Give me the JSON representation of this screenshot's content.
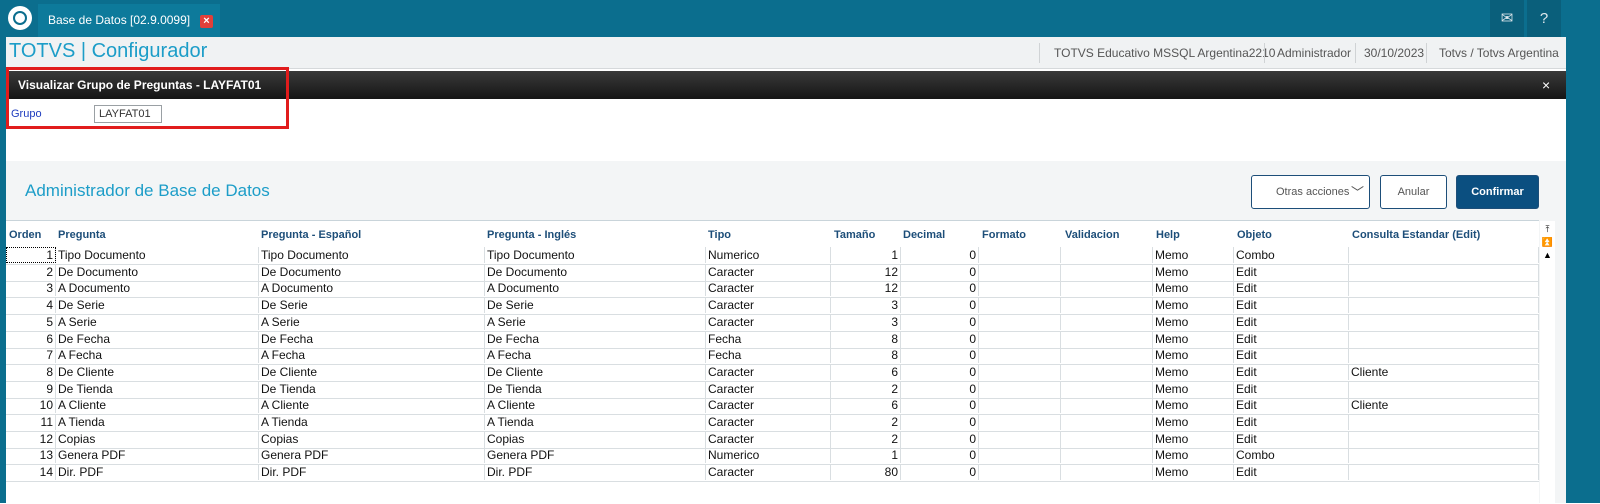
{
  "tab": {
    "title": "Base de Datos [02.9.0099]"
  },
  "app": {
    "title": "TOTVS | Configurador",
    "environment": "TOTVS Educativo MSSQL Argentina2210",
    "user": "Administrador",
    "date": "30/10/2023",
    "company": "Totvs / Totvs Argentina"
  },
  "icons": {
    "mail": "mail-icon",
    "help": "help-icon"
  },
  "colors": {
    "brand": "#0b6e8e",
    "accent": "#1c9dc8",
    "primary_button": "#0b4f80",
    "highlight": "#e11c1c"
  },
  "dialog": {
    "title": "Visualizar Grupo de Preguntas - LAYFAT01",
    "close": "×",
    "grupo_label": "Grupo",
    "grupo_value": "LAYFAT01"
  },
  "panel": {
    "title": "Administrador de Base de Datos",
    "other_actions": "Otras acciones",
    "cancel": "Anular",
    "confirm": "Confirmar"
  },
  "table": {
    "headers": [
      "Orden",
      "Pregunta",
      "Pregunta - Español",
      "Pregunta - Inglés",
      "Tipo",
      "Tamaño",
      "Decimal",
      "Formato",
      "Validacion",
      "Help",
      "Objeto",
      "Consulta Estandar (Edit)"
    ],
    "rows": [
      [
        "1",
        "Tipo Documento",
        "Tipo Documento",
        "Tipo Documento",
        "Numerico",
        "1",
        "0",
        "",
        "",
        "Memo",
        "Combo",
        ""
      ],
      [
        "2",
        "De Documento",
        "De Documento",
        "De Documento",
        "Caracter",
        "12",
        "0",
        "",
        "",
        "Memo",
        "Edit",
        ""
      ],
      [
        "3",
        "A Documento",
        "A Documento",
        "A Documento",
        "Caracter",
        "12",
        "0",
        "",
        "",
        "Memo",
        "Edit",
        ""
      ],
      [
        "4",
        "De Serie",
        "De Serie",
        "De Serie",
        "Caracter",
        "3",
        "0",
        "",
        "",
        "Memo",
        "Edit",
        ""
      ],
      [
        "5",
        "A Serie",
        "A Serie",
        "A Serie",
        "Caracter",
        "3",
        "0",
        "",
        "",
        "Memo",
        "Edit",
        ""
      ],
      [
        "6",
        "De Fecha",
        "De Fecha",
        "De Fecha",
        "Fecha",
        "8",
        "0",
        "",
        "",
        "Memo",
        "Edit",
        ""
      ],
      [
        "7",
        "A Fecha",
        "A Fecha",
        "A Fecha",
        "Fecha",
        "8",
        "0",
        "",
        "",
        "Memo",
        "Edit",
        ""
      ],
      [
        "8",
        "De Cliente",
        "De Cliente",
        "De Cliente",
        "Caracter",
        "6",
        "0",
        "",
        "",
        "Memo",
        "Edit",
        "Cliente"
      ],
      [
        "9",
        "De Tienda",
        "De Tienda",
        "De Tienda",
        "Caracter",
        "2",
        "0",
        "",
        "",
        "Memo",
        "Edit",
        ""
      ],
      [
        "10",
        "A Cliente",
        "A Cliente",
        "A Cliente",
        "Caracter",
        "6",
        "0",
        "",
        "",
        "Memo",
        "Edit",
        "Cliente"
      ],
      [
        "11",
        "A Tienda",
        "A Tienda",
        "A Tienda",
        "Caracter",
        "2",
        "0",
        "",
        "",
        "Memo",
        "Edit",
        ""
      ],
      [
        "12",
        "Copias",
        "Copias",
        "Copias",
        "Caracter",
        "2",
        "0",
        "",
        "",
        "Memo",
        "Edit",
        ""
      ],
      [
        "13",
        "Genera PDF",
        "Genera PDF",
        "Genera PDF",
        "Numerico",
        "1",
        "0",
        "",
        "",
        "Memo",
        "Combo",
        ""
      ],
      [
        "14",
        "Dir. PDF",
        "Dir. PDF",
        "Dir. PDF",
        "Caracter",
        "80",
        "0",
        "",
        "",
        "Memo",
        "Edit",
        ""
      ]
    ]
  }
}
